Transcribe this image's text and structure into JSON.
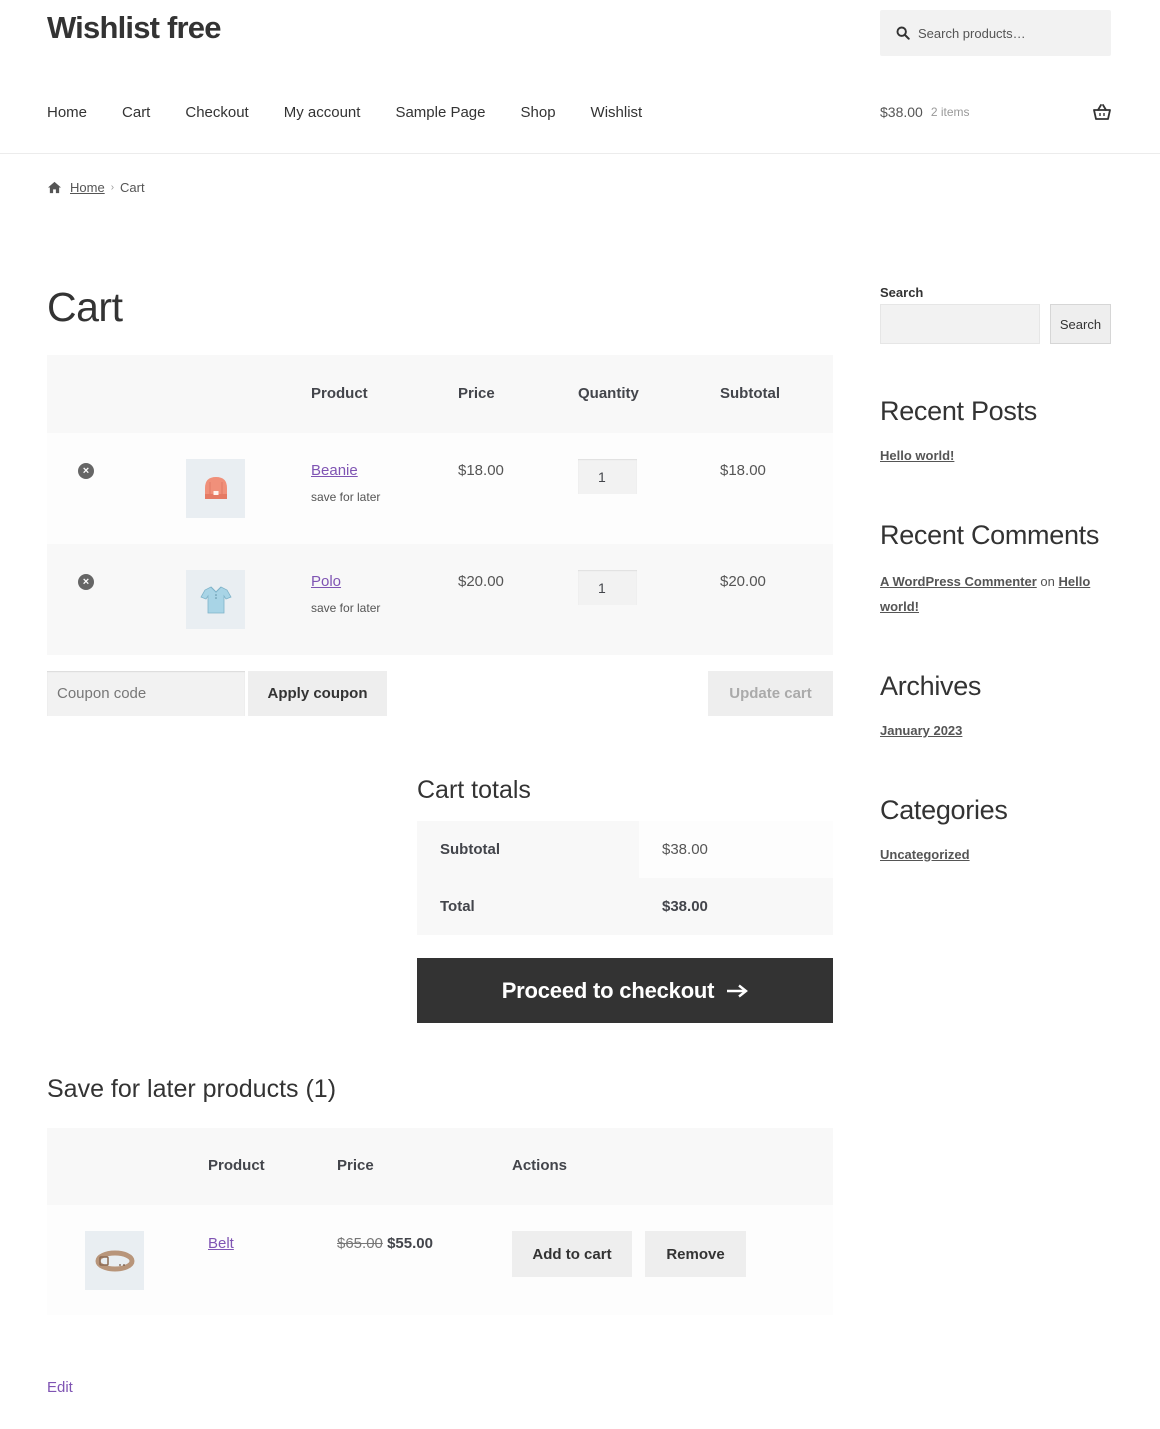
{
  "site": {
    "title": "Wishlist free"
  },
  "header_search": {
    "placeholder": "Search products…"
  },
  "nav": [
    "Home",
    "Cart",
    "Checkout",
    "My account",
    "Sample Page",
    "Shop",
    "Wishlist"
  ],
  "mini_cart": {
    "amount": "$38.00",
    "count": "2 items"
  },
  "breadcrumb": {
    "home": "Home",
    "current": "Cart"
  },
  "page_title": "Cart",
  "cart": {
    "headers": {
      "product": "Product",
      "price": "Price",
      "quantity": "Quantity",
      "subtotal": "Subtotal"
    },
    "items": [
      {
        "name": "Beanie",
        "action": "save for later",
        "price": "$18.00",
        "qty": "1",
        "subtotal": "$18.00",
        "icon": "beanie-icon"
      },
      {
        "name": "Polo",
        "action": "save for later",
        "price": "$20.00",
        "qty": "1",
        "subtotal": "$20.00",
        "icon": "polo-icon"
      }
    ],
    "coupon_placeholder": "Coupon code",
    "apply_coupon": "Apply coupon",
    "update_cart": "Update cart"
  },
  "totals": {
    "title": "Cart totals",
    "subtotal_label": "Subtotal",
    "subtotal_value": "$38.00",
    "total_label": "Total",
    "total_value": "$38.00",
    "checkout": "Proceed to checkout"
  },
  "save_for_later": {
    "title": "Save for later products (1)",
    "headers": {
      "product": "Product",
      "price": "Price",
      "actions": "Actions"
    },
    "items": [
      {
        "name": "Belt",
        "old_price": "$65.00",
        "sale_price": "$55.00",
        "add_to_cart": "Add to cart",
        "remove": "Remove",
        "icon": "belt-icon"
      }
    ]
  },
  "edit_link": "Edit",
  "sidebar": {
    "search_label": "Search",
    "search_button": "Search",
    "recent_posts_title": "Recent Posts",
    "recent_posts": [
      "Hello world!"
    ],
    "recent_comments_title": "Recent Comments",
    "comment": {
      "author": "A WordPress Commenter",
      "on": "on",
      "post": "Hello world!"
    },
    "archives_title": "Archives",
    "archives": [
      "January 2023"
    ],
    "categories_title": "Categories",
    "categories": [
      "Uncategorized"
    ]
  },
  "colors": {
    "link": "#7f54b3",
    "button_dark": "#333333",
    "button_light": "#eeeeee",
    "text": "#43454b"
  }
}
